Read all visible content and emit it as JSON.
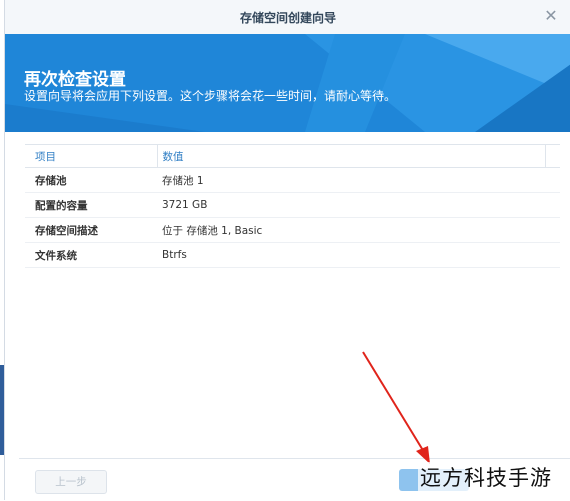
{
  "dialog": {
    "title": "存储空间创建向导",
    "close_icon": "close-icon"
  },
  "banner": {
    "title": "再次检查设置",
    "subtitle": "设置向导将会应用下列设置。这个步骤将会花一些时间，请耐心等待。",
    "color": "#1f86d8"
  },
  "table": {
    "headers": [
      "项目",
      "数值"
    ],
    "rows": [
      {
        "key": "存储池",
        "value": "存储池 1"
      },
      {
        "key": "配置的容量",
        "value": "3721 GB"
      },
      {
        "key": "存储空间描述",
        "value": "位于 存储池 1, Basic"
      },
      {
        "key": "文件系统",
        "value": "Btrfs"
      }
    ]
  },
  "footer": {
    "prev_label": "上一步"
  },
  "watermark": {
    "text": "远方科技手游"
  },
  "annotation": {
    "arrow_color": "#e0241b"
  }
}
